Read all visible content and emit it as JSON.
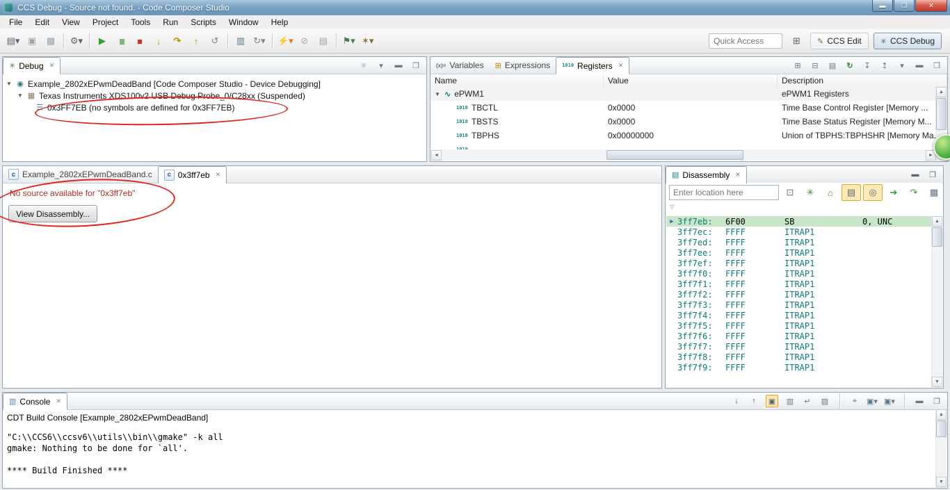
{
  "window": {
    "title": "CCS Debug - Source not found. - Code Composer Studio",
    "minimize_glyph": "▬",
    "maximize_glyph": "❐",
    "close_glyph": "✕"
  },
  "icons": {
    "close": "✕",
    "menu_dropdown": "▾",
    "twisty_open": "▼",
    "scroll_up": "▲",
    "scroll_down": "▼",
    "scroll_left": "◄",
    "scroll_right": "►",
    "pc_arrow": "▶",
    "chevron": "▽",
    "open_perspective": "⊞"
  },
  "menu": {
    "items": [
      "File",
      "Edit",
      "View",
      "Project",
      "Tools",
      "Run",
      "Scripts",
      "Window",
      "Help"
    ]
  },
  "toolbar": {
    "icons": [
      {
        "name": "new-wizard",
        "glyph": "▤▾",
        "style": "color:#5a6570"
      },
      {
        "name": "save",
        "glyph": "▣",
        "style": "color:#9aa4ad"
      },
      {
        "name": "save-all",
        "glyph": "▩",
        "style": "color:#9aa4ad"
      },
      {
        "name": "build",
        "glyph": "⚙▾",
        "style": "color:#5a6570"
      },
      {
        "name": "resume",
        "glyph": "▶",
        "style": "color:#2f9e2f"
      },
      {
        "name": "suspend",
        "glyph": "▮▮",
        "style": "color:#86b386;letter-spacing:-3px;font-size:11px"
      },
      {
        "name": "terminate",
        "glyph": "■",
        "style": "color:#c0392b"
      },
      {
        "name": "step-into",
        "glyph": "↓",
        "style": "color:#b8960c;font-weight:bold"
      },
      {
        "name": "step-over",
        "glyph": "↷",
        "style": "color:#b8960c;font-weight:bold"
      },
      {
        "name": "step-return",
        "glyph": "↑",
        "style": "color:#b8960c;font-weight:bold"
      },
      {
        "name": "restart",
        "glyph": "↺",
        "style": "color:#7a858f"
      },
      {
        "name": "assembly-step",
        "glyph": "▥",
        "style": "color:#56788a"
      },
      {
        "name": "reset-cpu",
        "glyph": "↻▾",
        "style": "color:#7a858f"
      },
      {
        "name": "flash",
        "glyph": "⚡▾",
        "style": "color:#e07b20"
      },
      {
        "name": "profile",
        "glyph": "⊘",
        "style": "color:#9aa4ad"
      },
      {
        "name": "trace",
        "glyph": "▤",
        "style": "color:#9aa4ad"
      },
      {
        "name": "debug-config",
        "glyph": "⚑▾",
        "style": "color:#4a7a4a"
      },
      {
        "name": "highlight",
        "glyph": "✶▾",
        "style": "color:#8a6d3b"
      }
    ],
    "quick_access_placeholder": "Quick Access",
    "perspectives": [
      {
        "icon": "✎",
        "label": "CCS Edit"
      },
      {
        "icon": "✳",
        "label": "CCS Debug"
      }
    ]
  },
  "debug_panel": {
    "tab_icon": "✳",
    "tab": "Debug",
    "toolbar": [
      {
        "name": "pinwheel",
        "glyph": "✳",
        "style": "color:#aab3bb"
      },
      {
        "name": "view-menu",
        "glyph": "▾",
        "style": "color:#6a7680"
      },
      {
        "name": "minimize",
        "glyph": "▬",
        "style": "color:#6a7680"
      },
      {
        "name": "maximize",
        "glyph": "❐",
        "style": "color:#6a7680"
      }
    ],
    "tree": [
      {
        "icon": "◉",
        "icon_style": "color:#2d7d7d",
        "label": "Example_2802xEPwmDeadBand [Code Composer Studio - Device Debugging]"
      },
      {
        "icon": "▦",
        "icon_style": "color:#8a7d5a",
        "label": "Texas Instruments XDS100v2 USB Debug Probe_0/C28xx (Suspended)"
      },
      {
        "icon": "☰",
        "icon_style": "color:#5b7fae",
        "label": "0x3FF7EB (no symbols are defined for 0x3FF7EB)"
      }
    ]
  },
  "registers_panel": {
    "tabs": [
      {
        "icon": "(x)=",
        "label": "Variables"
      },
      {
        "icon": "⊞",
        "label": "Expressions"
      },
      {
        "icon": "1010",
        "label": "Registers"
      }
    ],
    "toolbar": [
      {
        "name": "tree-mode",
        "glyph": "⊞",
        "style": "color:#6a7680"
      },
      {
        "name": "collapse-all",
        "glyph": "⊟",
        "style": "color:#6a7680"
      },
      {
        "name": "layout",
        "glyph": "▤",
        "style": "color:#6a7680"
      },
      {
        "name": "refresh",
        "glyph": "↻",
        "style": "color:#2d8f2d;font-weight:bold"
      },
      {
        "name": "import",
        "glyph": "↧",
        "style": "color:#6a7680"
      },
      {
        "name": "export",
        "glyph": "↥",
        "style": "color:#6a7680"
      },
      {
        "name": "view-menu",
        "glyph": "▾",
        "style": "color:#6a7680"
      },
      {
        "name": "minimize",
        "glyph": "▬",
        "style": "color:#6a7680"
      },
      {
        "name": "maximize",
        "glyph": "❐",
        "style": "color:#6a7680"
      }
    ],
    "columns": [
      "Name",
      "Value",
      "Description"
    ],
    "rows": [
      {
        "twisty": "▼",
        "icon": "∿",
        "name": "ePWM1",
        "value": "",
        "description": "ePWM1 Registers"
      },
      {
        "icon": "1010",
        "name": "TBCTL",
        "value": "0x0000",
        "description": "Time Base Control Register [Memory ..."
      },
      {
        "icon": "1010",
        "name": "TBSTS",
        "value": "0x0000",
        "description": "Time Base Status Register [Memory M..."
      },
      {
        "icon": "1010",
        "name": "TBPHS",
        "value": "0x00000000",
        "description": "Union of TBPHS:TBPHSHR [Memory Ma..."
      },
      {
        "icon": "1010",
        "name": "",
        "value": "",
        "description": ""
      }
    ]
  },
  "editor": {
    "tabs": [
      {
        "icon": "c",
        "label": "Example_2802xEPwmDeadBand.c"
      },
      {
        "icon": "c",
        "label": "0x3ff7eb"
      }
    ],
    "message": "No source available for \"0x3ff7eb\"",
    "button_label": "View Disassembly..."
  },
  "disassembly": {
    "tab_icon": "▤",
    "tab": "Disassembly",
    "location_placeholder": "Enter location here",
    "toolbar": [
      {
        "name": "pin",
        "glyph": "⊡",
        "style": "color:#6a7680"
      },
      {
        "name": "refresh",
        "glyph": "✳",
        "style": "color:#2d8f2d"
      },
      {
        "name": "home",
        "glyph": "⌂",
        "style": "color:#8a6d3b"
      },
      {
        "name": "show-source",
        "glyph": "▤",
        "style": "color:#56788a"
      },
      {
        "name": "track-pc",
        "glyph": "◎",
        "style": "color:#56788a"
      },
      {
        "name": "run-to-line",
        "glyph": "➔",
        "style": "color:#2f9e2f"
      },
      {
        "name": "resume-from",
        "glyph": "↷",
        "style": "color:#2f9e2f"
      },
      {
        "name": "copy-view",
        "glyph": "▩",
        "style": "color:#6a7680"
      },
      {
        "name": "new-view",
        "glyph": "▦",
        "style": "color:#6a7680"
      }
    ],
    "rows": [
      {
        "addr": "3ff7eb:",
        "opcode": "6F00",
        "mnemonic": "SB",
        "operands": "0, UNC"
      },
      {
        "addr": "3ff7ec:",
        "opcode": "FFFF",
        "mnemonic": "ITRAP1",
        "operands": ""
      },
      {
        "addr": "3ff7ed:",
        "opcode": "FFFF",
        "mnemonic": "ITRAP1",
        "operands": ""
      },
      {
        "addr": "3ff7ee:",
        "opcode": "FFFF",
        "mnemonic": "ITRAP1",
        "operands": ""
      },
      {
        "addr": "3ff7ef:",
        "opcode": "FFFF",
        "mnemonic": "ITRAP1",
        "operands": ""
      },
      {
        "addr": "3ff7f0:",
        "opcode": "FFFF",
        "mnemonic": "ITRAP1",
        "operands": ""
      },
      {
        "addr": "3ff7f1:",
        "opcode": "FFFF",
        "mnemonic": "ITRAP1",
        "operands": ""
      },
      {
        "addr": "3ff7f2:",
        "opcode": "FFFF",
        "mnemonic": "ITRAP1",
        "operands": ""
      },
      {
        "addr": "3ff7f3:",
        "opcode": "FFFF",
        "mnemonic": "ITRAP1",
        "operands": ""
      },
      {
        "addr": "3ff7f4:",
        "opcode": "FFFF",
        "mnemonic": "ITRAP1",
        "operands": ""
      },
      {
        "addr": "3ff7f5:",
        "opcode": "FFFF",
        "mnemonic": "ITRAP1",
        "operands": ""
      },
      {
        "addr": "3ff7f6:",
        "opcode": "FFFF",
        "mnemonic": "ITRAP1",
        "operands": ""
      },
      {
        "addr": "3ff7f7:",
        "opcode": "FFFF",
        "mnemonic": "ITRAP1",
        "operands": ""
      },
      {
        "addr": "3ff7f8:",
        "opcode": "FFFF",
        "mnemonic": "ITRAP1",
        "operands": ""
      },
      {
        "addr": "3ff7f9:",
        "opcode": "FFFF",
        "mnemonic": "ITRAP1",
        "operands": ""
      }
    ]
  },
  "console": {
    "tab_icon": "▥",
    "tab": "Console",
    "title": "CDT Build Console [Example_2802xEPwmDeadBand]",
    "text": "\"C:\\\\CCS6\\\\ccsv6\\\\utils\\\\bin\\\\gmake\" -k all\ngmake: Nothing to be done for `all'.\n\n**** Build Finished ****",
    "toolbar": [
      {
        "name": "next-error",
        "glyph": "↓",
        "style": "color:#2b5fa5;font-weight:bold"
      },
      {
        "name": "prev-error",
        "glyph": "↑",
        "style": "color:#2b5fa5;font-weight:bold"
      },
      {
        "name": "show-error",
        "glyph": "▣",
        "style": "color:#56788a"
      },
      {
        "name": "scroll-lock",
        "glyph": "▥",
        "style": "color:#6a7680"
      },
      {
        "name": "word-wrap",
        "glyph": "↵",
        "style": "color:#6a7680"
      },
      {
        "name": "clear-console",
        "glyph": "▨",
        "style": "color:#6a7680"
      },
      {
        "name": "pin-console",
        "glyph": "⌖",
        "style": "color:#6a7680"
      },
      {
        "name": "display-console",
        "glyph": "▣▾",
        "style": "color:#56788a"
      },
      {
        "name": "open-console",
        "glyph": "▣▾",
        "style": "color:#56788a"
      },
      {
        "name": "minimize",
        "glyph": "▬",
        "style": "color:#6a7680"
      },
      {
        "name": "maximize",
        "glyph": "❐",
        "style": "color:#6a7680"
      }
    ]
  }
}
